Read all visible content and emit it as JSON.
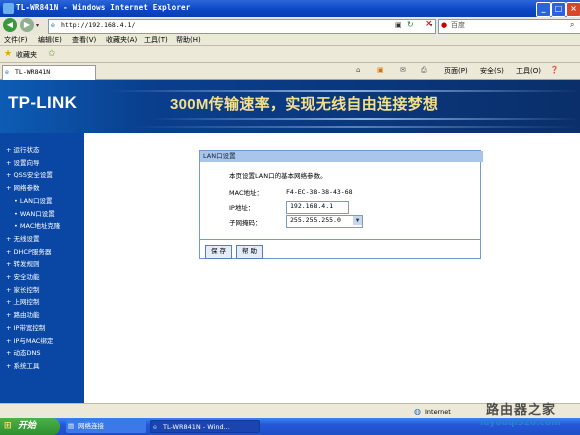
{
  "window": {
    "title": "TL-WR841N - Windows Internet Explorer"
  },
  "address": {
    "url": "http://192.168.4.1/",
    "search_placeholder": "百度"
  },
  "menu": [
    "文件(F)",
    "编辑(E)",
    "查看(V)",
    "收藏夹(A)",
    "工具(T)",
    "帮助(H)"
  ],
  "favorites": {
    "label": "收藏夹"
  },
  "tab": {
    "title": "TL-WR841N"
  },
  "command_bar": {
    "page": "页面(P)",
    "safety": "安全(S)",
    "tools": "工具(O)"
  },
  "banner": {
    "logo": "TP-LINK",
    "slogan": "300M传输速率，实现无线自由连接梦想"
  },
  "sidebar": {
    "items": [
      {
        "label": "运行状态",
        "sub": false
      },
      {
        "label": "设置向导",
        "sub": false
      },
      {
        "label": "QSS安全设置",
        "sub": false
      },
      {
        "label": "网络参数",
        "sub": false
      },
      {
        "label": "LAN口设置",
        "sub": true
      },
      {
        "label": "WAN口设置",
        "sub": true
      },
      {
        "label": "MAC地址克隆",
        "sub": true
      },
      {
        "label": "无线设置",
        "sub": false
      },
      {
        "label": "DHCP服务器",
        "sub": false
      },
      {
        "label": "转发规则",
        "sub": false
      },
      {
        "label": "安全功能",
        "sub": false
      },
      {
        "label": "家长控制",
        "sub": false
      },
      {
        "label": "上网控制",
        "sub": false
      },
      {
        "label": "路由功能",
        "sub": false
      },
      {
        "label": "IP带宽控制",
        "sub": false
      },
      {
        "label": "IP与MAC绑定",
        "sub": false
      },
      {
        "label": "动态DNS",
        "sub": false
      },
      {
        "label": "系统工具",
        "sub": false
      }
    ]
  },
  "panel": {
    "title": "LAN口设置",
    "description": "本页设置LAN口的基本网络参数。",
    "mac_label": "MAC地址：",
    "mac_value": "F4-EC-38-38-43-68",
    "ip_label": "IP地址：",
    "ip_value": "192.168.4.1",
    "mask_label": "子网掩码：",
    "mask_value": "255.255.255.0",
    "save_button": "保 存",
    "help_button": "帮 助"
  },
  "status": {
    "zone": "Internet"
  },
  "taskbar": {
    "start": "开始",
    "tasks": [
      "网络连接",
      "TL-WR841N - Wind..."
    ]
  },
  "watermark": {
    "text": "路由器之家",
    "domain": "luyouqi520.com"
  }
}
